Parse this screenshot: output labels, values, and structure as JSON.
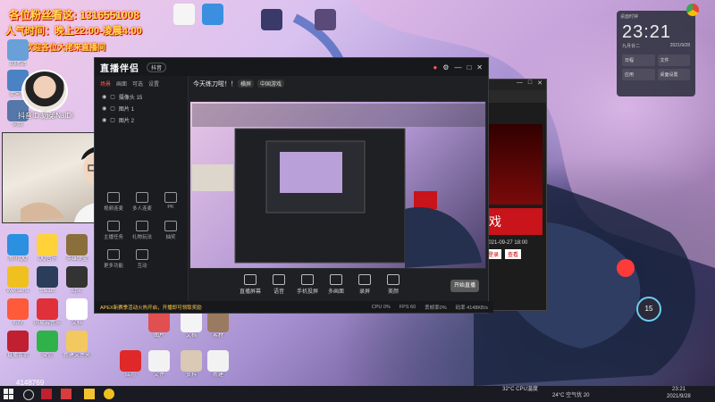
{
  "overlay": {
    "line1": "各位粉丝看这: 1316551008",
    "line2": "人气时间：晚上22:00-凌晨4:00",
    "line3": "欢迎各位大佬来直播间",
    "streamer_id": "抖音ID:奶弟NaiDi",
    "viewer_count": "4148769"
  },
  "desktop_icons_left": [
    {
      "label": "回收站",
      "color": "#6aa0d8"
    },
    {
      "label": "此电脑",
      "color": "#4b82c4"
    },
    {
      "label": "网络",
      "color": "#5577aa"
    },
    {
      "label": "Chrome",
      "color": "#e8b33a"
    },
    {
      "label": "Edge",
      "color": "#2f7fd0"
    },
    {
      "label": "应用",
      "color": "#3a6fc2"
    },
    {
      "label": "QQ",
      "color": "#3fa7e0"
    }
  ],
  "desktop_icons_grid": [
    {
      "label": "腾讯QQ",
      "color": "#2b90e0"
    },
    {
      "label": "QQ音乐",
      "color": "#ffd23a"
    },
    {
      "label": "英雄联盟",
      "color": "#8a6f3c"
    },
    {
      "label": "WeGame",
      "color": "#f0c020"
    },
    {
      "label": "Steam",
      "color": "#2a3d5a"
    },
    {
      "label": "Epic",
      "color": "#333333"
    },
    {
      "label": "剪映",
      "color": "#ff5a3a"
    },
    {
      "label": "网易云音乐",
      "color": "#e0303a"
    },
    {
      "label": "文档",
      "color": "#ffffff"
    },
    {
      "label": "直播伴侣",
      "color": "#c02030"
    },
    {
      "label": "微信",
      "color": "#2fb24a"
    },
    {
      "label": "新建文件夹",
      "color": "#f4c860"
    }
  ],
  "app": {
    "logo": "直播伴侣",
    "title_tab": "抖音",
    "title_text": "今天练刀啦！！！",
    "tags": [
      "横屏",
      "中国游戏"
    ],
    "left_tabs": [
      "场景",
      "画面",
      "可选",
      "设置"
    ],
    "sources": [
      "摄像头 15",
      "图片 1",
      "图片 2"
    ],
    "add_btn": "添加",
    "grid_buttons": [
      "视频连麦",
      "多人连麦",
      "PK",
      "主播任务",
      "礼物玩法",
      "抽奖",
      "更多功能",
      "互动"
    ],
    "bottom_buttons": [
      "直播屏幕",
      "语音",
      "手机投屏",
      "多画面",
      "录屏",
      "美颜"
    ],
    "start_btn": "开始直播",
    "notice": "APEX新赛季活动火热开启，开播即可领取奖励",
    "status_items": [
      "CPU 0%",
      "FPS 60",
      "丢帧率0%",
      "码率 4148KB/s"
    ]
  },
  "widget": {
    "label": "桌面时钟",
    "time": "23:21",
    "date1": "九月廿二",
    "date2": "2021/9/28",
    "items": [
      "日程",
      "文件",
      "应用",
      "桌面设置"
    ]
  },
  "browser_snip": {
    "game_text": "戏",
    "date": "2021-09-27 18:00",
    "btn1": "登录",
    "btn2": "查看"
  },
  "badge": {
    "value": "15"
  },
  "taskbar": {
    "weather": "24°C 空气优 20",
    "time": "23:21",
    "date": "2021/9/28",
    "cpu": "32°C CPU温度"
  },
  "colors": {
    "accent": "#ff5a5a",
    "app_bg": "#1e2024"
  }
}
